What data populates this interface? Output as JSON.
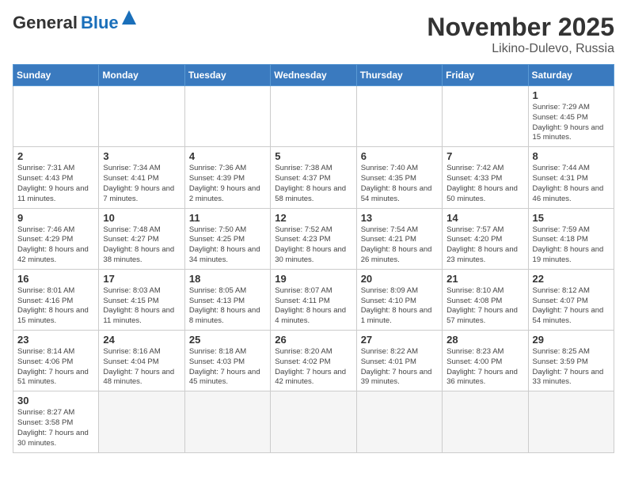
{
  "header": {
    "logo_general": "General",
    "logo_blue": "Blue",
    "month_title": "November 2025",
    "location": "Likino-Dulevo, Russia"
  },
  "days_of_week": [
    "Sunday",
    "Monday",
    "Tuesday",
    "Wednesday",
    "Thursday",
    "Friday",
    "Saturday"
  ],
  "weeks": [
    [
      {
        "day": null
      },
      {
        "day": null
      },
      {
        "day": null
      },
      {
        "day": null
      },
      {
        "day": null
      },
      {
        "day": null
      },
      {
        "day": 1,
        "sunrise": "7:29 AM",
        "sunset": "4:45 PM",
        "daylight": "9 hours and 15 minutes."
      }
    ],
    [
      {
        "day": 2,
        "sunrise": "7:31 AM",
        "sunset": "4:43 PM",
        "daylight": "9 hours and 11 minutes."
      },
      {
        "day": 3,
        "sunrise": "7:34 AM",
        "sunset": "4:41 PM",
        "daylight": "9 hours and 7 minutes."
      },
      {
        "day": 4,
        "sunrise": "7:36 AM",
        "sunset": "4:39 PM",
        "daylight": "9 hours and 2 minutes."
      },
      {
        "day": 5,
        "sunrise": "7:38 AM",
        "sunset": "4:37 PM",
        "daylight": "8 hours and 58 minutes."
      },
      {
        "day": 6,
        "sunrise": "7:40 AM",
        "sunset": "4:35 PM",
        "daylight": "8 hours and 54 minutes."
      },
      {
        "day": 7,
        "sunrise": "7:42 AM",
        "sunset": "4:33 PM",
        "daylight": "8 hours and 50 minutes."
      },
      {
        "day": 8,
        "sunrise": "7:44 AM",
        "sunset": "4:31 PM",
        "daylight": "8 hours and 46 minutes."
      }
    ],
    [
      {
        "day": 9,
        "sunrise": "7:46 AM",
        "sunset": "4:29 PM",
        "daylight": "8 hours and 42 minutes."
      },
      {
        "day": 10,
        "sunrise": "7:48 AM",
        "sunset": "4:27 PM",
        "daylight": "8 hours and 38 minutes."
      },
      {
        "day": 11,
        "sunrise": "7:50 AM",
        "sunset": "4:25 PM",
        "daylight": "8 hours and 34 minutes."
      },
      {
        "day": 12,
        "sunrise": "7:52 AM",
        "sunset": "4:23 PM",
        "daylight": "8 hours and 30 minutes."
      },
      {
        "day": 13,
        "sunrise": "7:54 AM",
        "sunset": "4:21 PM",
        "daylight": "8 hours and 26 minutes."
      },
      {
        "day": 14,
        "sunrise": "7:57 AM",
        "sunset": "4:20 PM",
        "daylight": "8 hours and 23 minutes."
      },
      {
        "day": 15,
        "sunrise": "7:59 AM",
        "sunset": "4:18 PM",
        "daylight": "8 hours and 19 minutes."
      }
    ],
    [
      {
        "day": 16,
        "sunrise": "8:01 AM",
        "sunset": "4:16 PM",
        "daylight": "8 hours and 15 minutes."
      },
      {
        "day": 17,
        "sunrise": "8:03 AM",
        "sunset": "4:15 PM",
        "daylight": "8 hours and 11 minutes."
      },
      {
        "day": 18,
        "sunrise": "8:05 AM",
        "sunset": "4:13 PM",
        "daylight": "8 hours and 8 minutes."
      },
      {
        "day": 19,
        "sunrise": "8:07 AM",
        "sunset": "4:11 PM",
        "daylight": "8 hours and 4 minutes."
      },
      {
        "day": 20,
        "sunrise": "8:09 AM",
        "sunset": "4:10 PM",
        "daylight": "8 hours and 1 minute."
      },
      {
        "day": 21,
        "sunrise": "8:10 AM",
        "sunset": "4:08 PM",
        "daylight": "7 hours and 57 minutes."
      },
      {
        "day": 22,
        "sunrise": "8:12 AM",
        "sunset": "4:07 PM",
        "daylight": "7 hours and 54 minutes."
      }
    ],
    [
      {
        "day": 23,
        "sunrise": "8:14 AM",
        "sunset": "4:06 PM",
        "daylight": "7 hours and 51 minutes."
      },
      {
        "day": 24,
        "sunrise": "8:16 AM",
        "sunset": "4:04 PM",
        "daylight": "7 hours and 48 minutes."
      },
      {
        "day": 25,
        "sunrise": "8:18 AM",
        "sunset": "4:03 PM",
        "daylight": "7 hours and 45 minutes."
      },
      {
        "day": 26,
        "sunrise": "8:20 AM",
        "sunset": "4:02 PM",
        "daylight": "7 hours and 42 minutes."
      },
      {
        "day": 27,
        "sunrise": "8:22 AM",
        "sunset": "4:01 PM",
        "daylight": "7 hours and 39 minutes."
      },
      {
        "day": 28,
        "sunrise": "8:23 AM",
        "sunset": "4:00 PM",
        "daylight": "7 hours and 36 minutes."
      },
      {
        "day": 29,
        "sunrise": "8:25 AM",
        "sunset": "3:59 PM",
        "daylight": "7 hours and 33 minutes."
      }
    ],
    [
      {
        "day": 30,
        "sunrise": "8:27 AM",
        "sunset": "3:58 PM",
        "daylight": "7 hours and 30 minutes."
      },
      {
        "day": null
      },
      {
        "day": null
      },
      {
        "day": null
      },
      {
        "day": null
      },
      {
        "day": null
      },
      {
        "day": null
      }
    ]
  ]
}
